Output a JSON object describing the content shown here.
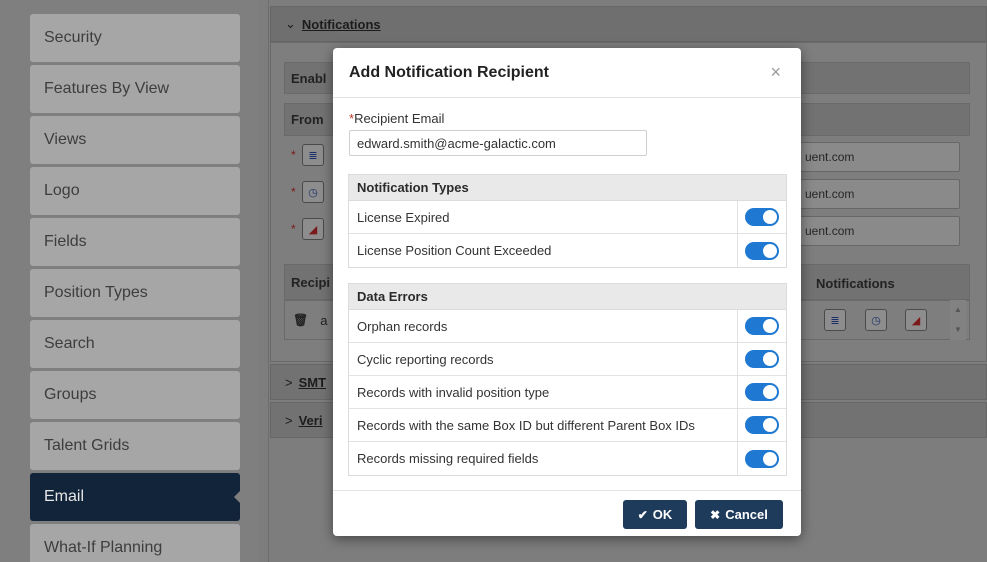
{
  "sidebar": {
    "items": [
      {
        "label": "Security"
      },
      {
        "label": "Features By View"
      },
      {
        "label": "Views"
      },
      {
        "label": "Logo"
      },
      {
        "label": "Fields"
      },
      {
        "label": "Position Types"
      },
      {
        "label": "Search"
      },
      {
        "label": "Groups"
      },
      {
        "label": "Talent Grids"
      },
      {
        "label": "Email",
        "active": true
      },
      {
        "label": "What-If Planning"
      }
    ]
  },
  "background": {
    "notifications_header": "Notifications",
    "enable_label": "Enabl",
    "from_label": "From",
    "email_suffix_1": "uent.com",
    "email_suffix_2": "uent.com",
    "email_suffix_3": "uent.com",
    "recipients_label": "Recipi",
    "notifications_col": "Notifications",
    "row_fragment": "a",
    "smtp_header": "SMT",
    "verify_header": "Veri"
  },
  "modal": {
    "title": "Add Notification Recipient",
    "close_glyph": "×",
    "recipient_email_label": "Recipient Email",
    "recipient_email_required": "*",
    "recipient_email_value": "edward.smith@acme-galactic.com",
    "notification_types": {
      "title": "Notification Types",
      "rows": [
        {
          "label": "License Expired",
          "enabled": true
        },
        {
          "label": "License Position Count Exceeded",
          "enabled": true
        }
      ]
    },
    "data_errors": {
      "title": "Data Errors",
      "rows": [
        {
          "label": "Orphan records",
          "enabled": true
        },
        {
          "label": "Cyclic reporting records",
          "enabled": true
        },
        {
          "label": "Records with invalid position type",
          "enabled": true
        },
        {
          "label": "Records with the same Box ID but different Parent Box IDs",
          "enabled": true
        },
        {
          "label": "Records missing required fields",
          "enabled": true
        }
      ]
    },
    "ok_label": "OK",
    "cancel_label": "Cancel"
  },
  "colors": {
    "accent": "#1f78d1",
    "button": "#1f3b5c",
    "sidebar_active": "#11243a"
  }
}
